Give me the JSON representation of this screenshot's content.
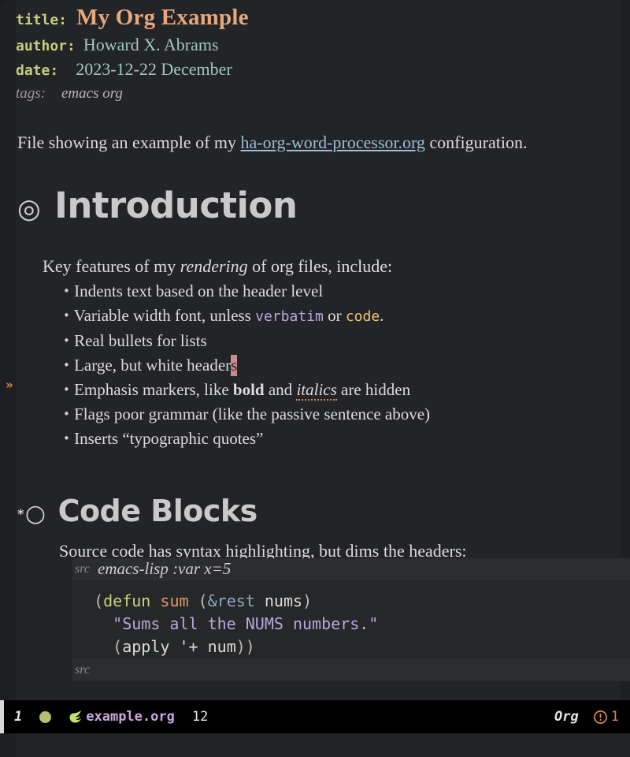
{
  "window": {
    "background": "#232427",
    "fringe_color": "#1e1f22",
    "accent_orange": "#e8a87c",
    "link_color": "#9bbdd8",
    "cursor_color": "#c98b8b"
  },
  "fringe": {
    "continuation_marker": "»"
  },
  "keywords": [
    {
      "key": "title:",
      "value": "My Org Example"
    },
    {
      "key": "author:",
      "value": "Howard X. Abrams"
    },
    {
      "key": "date:",
      "value": "2023-12-22 December"
    },
    {
      "key": "tags:",
      "value": "emacs org"
    }
  ],
  "intro_paragraph": {
    "before": "File showing an example of my ",
    "link": "ha-org-word-processor.org",
    "after": " configuration."
  },
  "sections": [
    {
      "bullet": "◎",
      "stars": "",
      "title": "Introduction",
      "lead": {
        "part1": "Key features of my ",
        "italic": "rendering",
        "part2": " of org files, include:"
      },
      "items": [
        {
          "bullet": "•",
          "text": "Indents text based on the header level"
        },
        {
          "bullet": "•",
          "text": "Variable width font, unless ",
          "verbatim": "verbatim",
          "mid": " or ",
          "code": "code",
          "tail": "."
        },
        {
          "bullet": "•",
          "text": "Real bullets for lists"
        },
        {
          "bullet": "•",
          "text": "Large, but white header",
          "cursor_char": "s"
        },
        {
          "bullet": "•",
          "text": "Emphasis markers, like ",
          "bold": "bold",
          "mid": " and ",
          "italic": "italics",
          "tail": " are hidden"
        },
        {
          "bullet": "•",
          "text": "Flags poor grammar (like the passive sentence above)"
        },
        {
          "bullet": "•",
          "text": "Inserts “typographic quotes”"
        }
      ]
    },
    {
      "bullet": "○",
      "stars": "*",
      "title": "Code Blocks",
      "lead_plain": "Source code has syntax highlighting, but dims the headers:"
    }
  ],
  "src_block": {
    "begin_label": "src",
    "begin_args": "emacs-lisp :var x=5",
    "end_label": "src",
    "lines": [
      {
        "indent": "  ",
        "tokens": [
          {
            "t": "(",
            "c": "c-paren"
          },
          {
            "t": "defun",
            "c": "c-kw"
          },
          {
            "t": " ",
            "c": "c-var"
          },
          {
            "t": "sum",
            "c": "c-fn"
          },
          {
            "t": " (",
            "c": "c-paren"
          },
          {
            "t": "&rest",
            "c": "c-amp"
          },
          {
            "t": " ",
            "c": "c-var"
          },
          {
            "t": "nums",
            "c": "c-var"
          },
          {
            "t": ")",
            "c": "c-paren"
          }
        ]
      },
      {
        "indent": "    ",
        "tokens": [
          {
            "t": "\"Sums all the NUMS numbers.\"",
            "c": "c-str"
          }
        ]
      },
      {
        "indent": "    ",
        "tokens": [
          {
            "t": "(",
            "c": "c-paren"
          },
          {
            "t": "apply",
            "c": "c-var"
          },
          {
            "t": " ",
            "c": "c-var"
          },
          {
            "t": "'+",
            "c": "c-var"
          },
          {
            "t": " ",
            "c": "c-var"
          },
          {
            "t": "num",
            "c": "c-var"
          },
          {
            "t": "))",
            "c": "c-paren"
          }
        ]
      }
    ]
  },
  "modeline": {
    "position_indicator": "1",
    "status_dot_color": "#b9bc72",
    "org_icon": "org-mode-icon",
    "buffer_name": "example.org",
    "line_number": "12",
    "major_mode": "Org",
    "warning_icon": "warning-circle-icon",
    "warning_count": "1",
    "warning_color": "#d98a4e"
  }
}
